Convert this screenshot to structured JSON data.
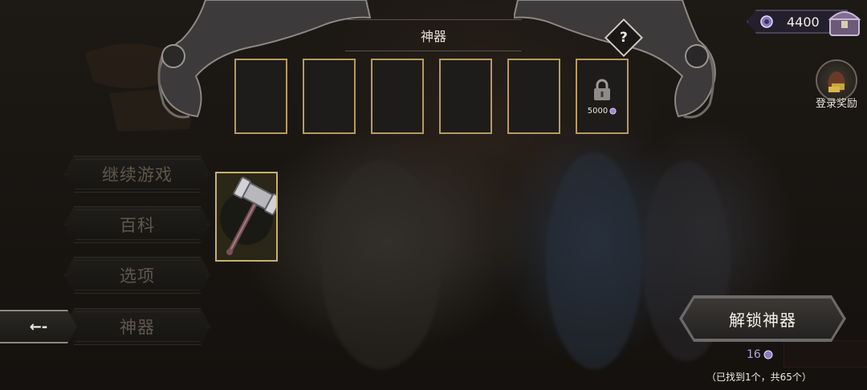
{
  "header": {
    "title": "神器",
    "help_label": "?"
  },
  "artifact_slots": {
    "count_empty": 5,
    "locked_slot_price": "5000"
  },
  "menu": {
    "items": [
      {
        "label": "继续游戏"
      },
      {
        "label": "百科"
      },
      {
        "label": "选项"
      },
      {
        "label": "神器"
      }
    ],
    "back_label": "←-"
  },
  "currency": {
    "value": "4400",
    "icon": "purple-gem-icon"
  },
  "login_reward": {
    "label": "登录奖励"
  },
  "unlock": {
    "button_label": "解锁神器",
    "cost": "16",
    "found_text": "（已找到1个，共65个）"
  },
  "colors": {
    "slot_border": "#b89a5e",
    "gem_purple": "#9b86d0",
    "selected_card_border": "#c8b06e"
  }
}
